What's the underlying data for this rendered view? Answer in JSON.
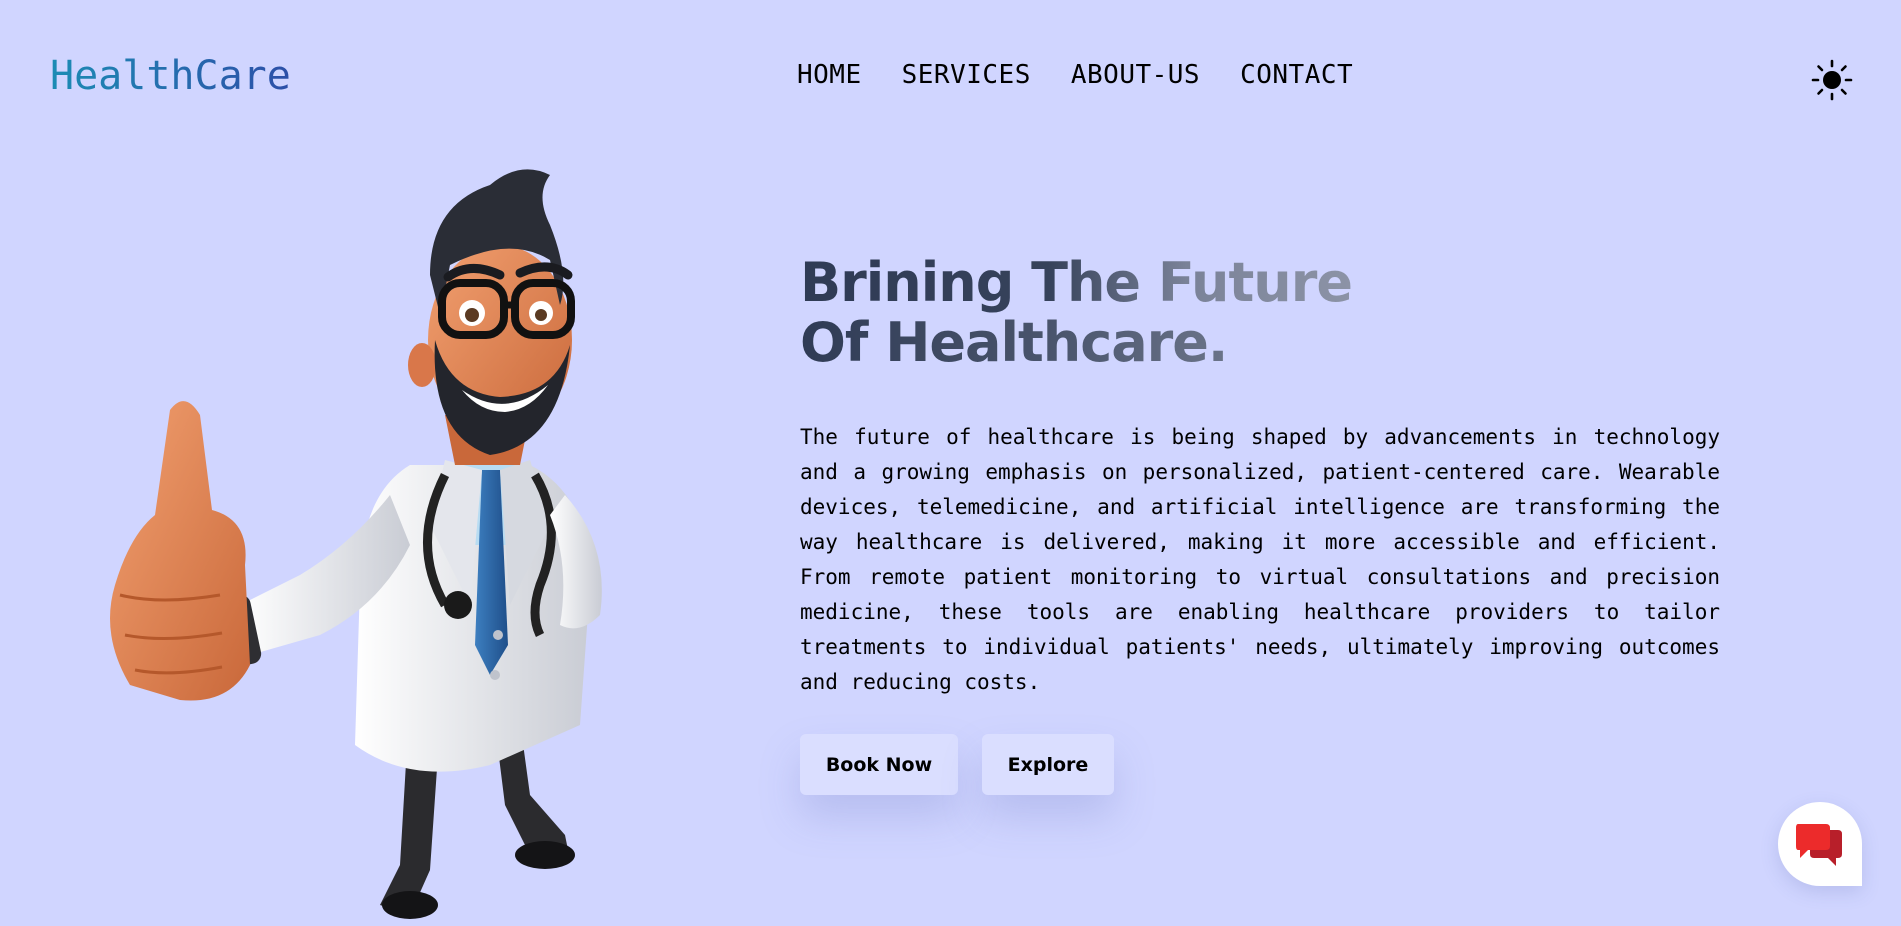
{
  "navbar": {
    "logo": "HealthCare",
    "links": [
      {
        "label": "HOME"
      },
      {
        "label": "SERVICES"
      },
      {
        "label": "ABOUT-US"
      },
      {
        "label": "CONTACT"
      }
    ],
    "theme_icon": "sun-icon"
  },
  "hero": {
    "title_line1": "Brining The Future",
    "title_line2": "Of Healthcare.",
    "description": "The future of healthcare is being shaped by advancements in technology and a growing emphasis on personalized, patient-centered care. Wearable devices, telemedicine, and artificial intelligence are transforming the way healthcare is delivered, making it more accessible and efficient. From remote patient monitoring to virtual consultations and precision medicine, these tools are enabling healthcare providers to tailor treatments to individual patients' needs, ultimately improving outcomes and reducing costs.",
    "buttons": {
      "book": "Book Now",
      "explore": "Explore"
    },
    "illustration": "doctor-thumbs-up-illustration"
  },
  "chat": {
    "icon": "chat-bubbles-icon"
  },
  "colors": {
    "background": "#d0d5ff",
    "logo_gradient_start": "#1c8cb4",
    "logo_gradient_end": "#2d4fa8",
    "button_bg": "#dadeff",
    "chat_icon": "#e02a2a"
  }
}
